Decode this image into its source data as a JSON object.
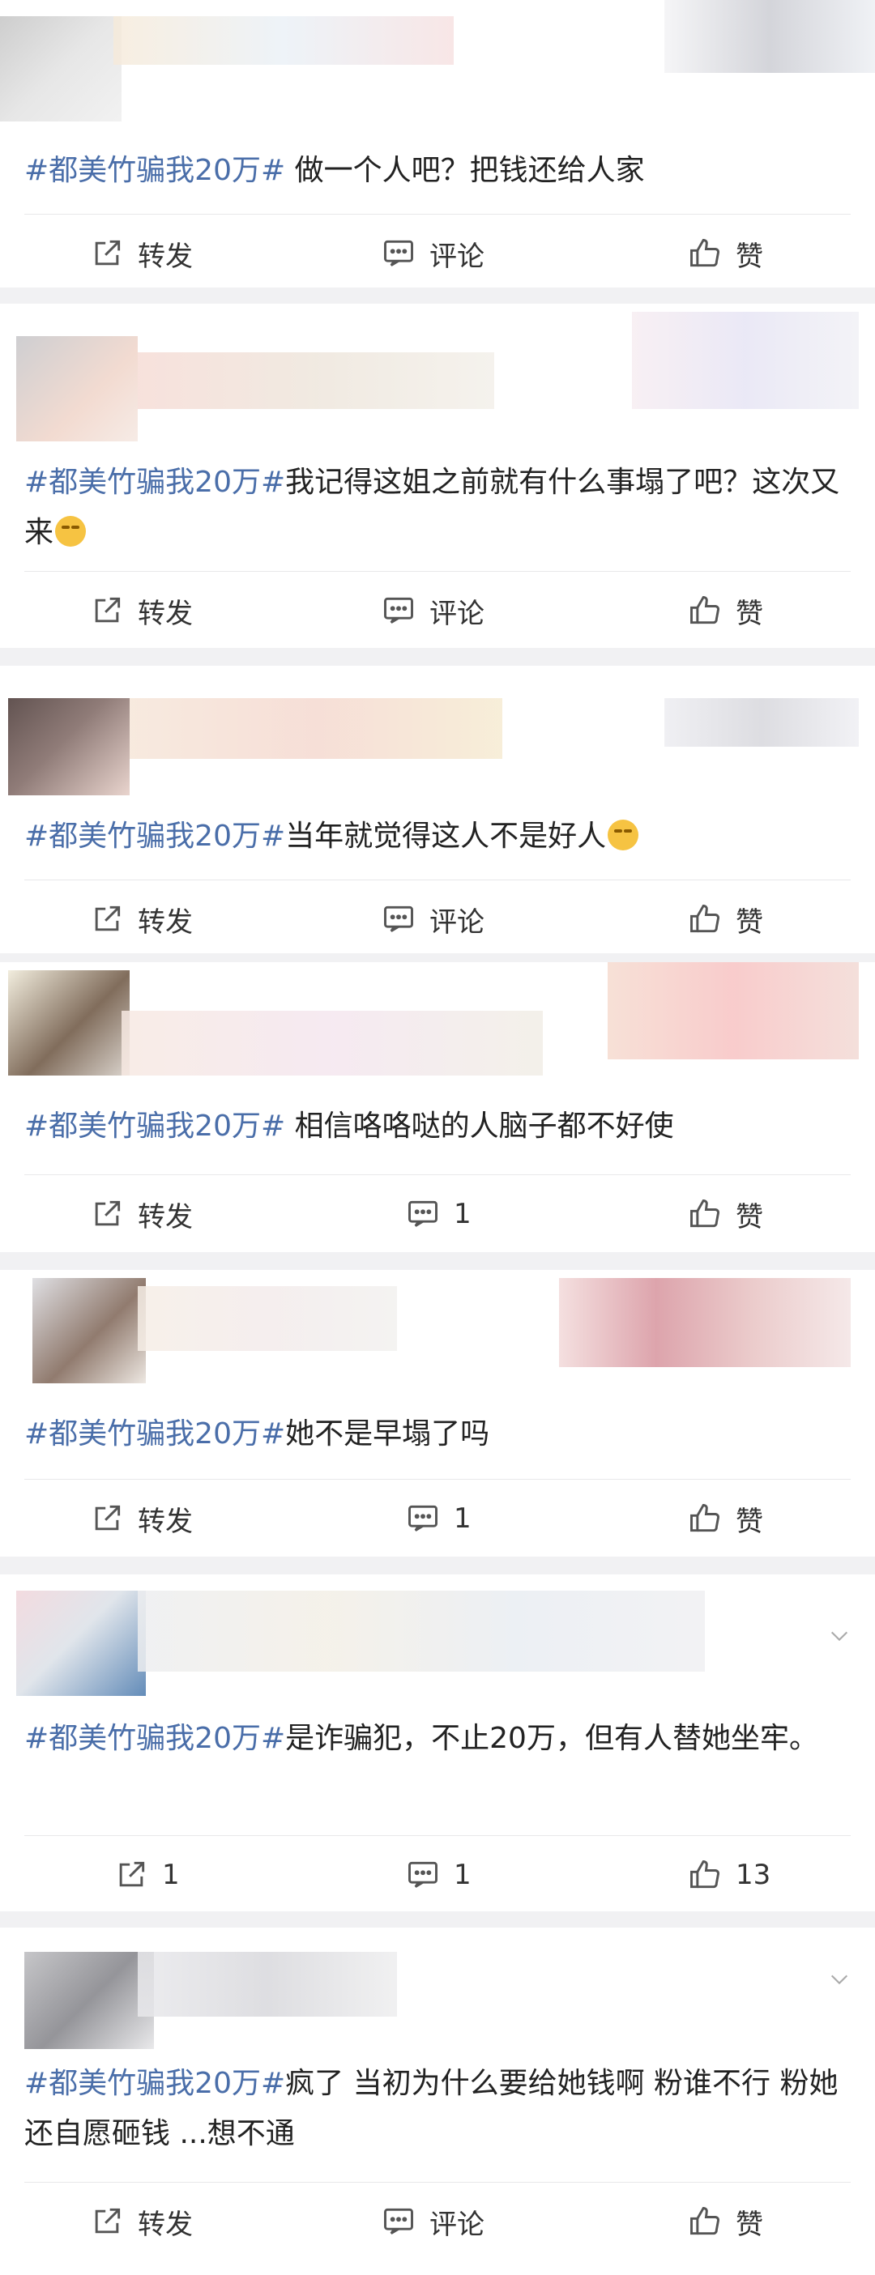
{
  "hashtag": "#都美竹骗我20万#",
  "labels": {
    "repost": "转发",
    "comment": "评论",
    "like": "赞"
  },
  "posts": [
    {
      "text": " 做一个人吧？把钱还给人家",
      "repost": "转发",
      "comment": "评论",
      "like": "赞",
      "emoji": ""
    },
    {
      "text": "我记得这姐之前就有什么事塌了吧？这次又来",
      "repost": "转发",
      "comment": "评论",
      "like": "赞",
      "emoji": "laughing-tears-emoji"
    },
    {
      "text": "当年就觉得这人不是好人",
      "repost": "转发",
      "comment": "评论",
      "like": "赞",
      "emoji": "smirk-emoji"
    },
    {
      "text": " 相信咯咯哒的人脑子都不好使",
      "repost": "转发",
      "comment": "1",
      "like": "赞",
      "emoji": ""
    },
    {
      "text": "她不是早塌了吗",
      "repost": "转发",
      "comment": "1",
      "like": "赞",
      "emoji": ""
    },
    {
      "text": "是诈骗犯，不止20万，但有人替她坐牢。",
      "repost": "1",
      "comment": "1",
      "like": "13",
      "emoji": ""
    },
    {
      "text": "疯了 当初为什么要给她钱啊 粉谁不行 粉她 还自愿砸钱 ...想不通",
      "repost": "转发",
      "comment": "评论",
      "like": "赞",
      "emoji": ""
    }
  ],
  "colors": {
    "hashtag": "#4a6ea9",
    "text": "#222222",
    "page_bg": "#f1f1f3",
    "card_bg": "#ffffff"
  },
  "icons": {
    "repost": "repost-icon",
    "comment": "comment-icon",
    "like": "thumbs-up-icon",
    "more": "chevron-down-icon"
  }
}
